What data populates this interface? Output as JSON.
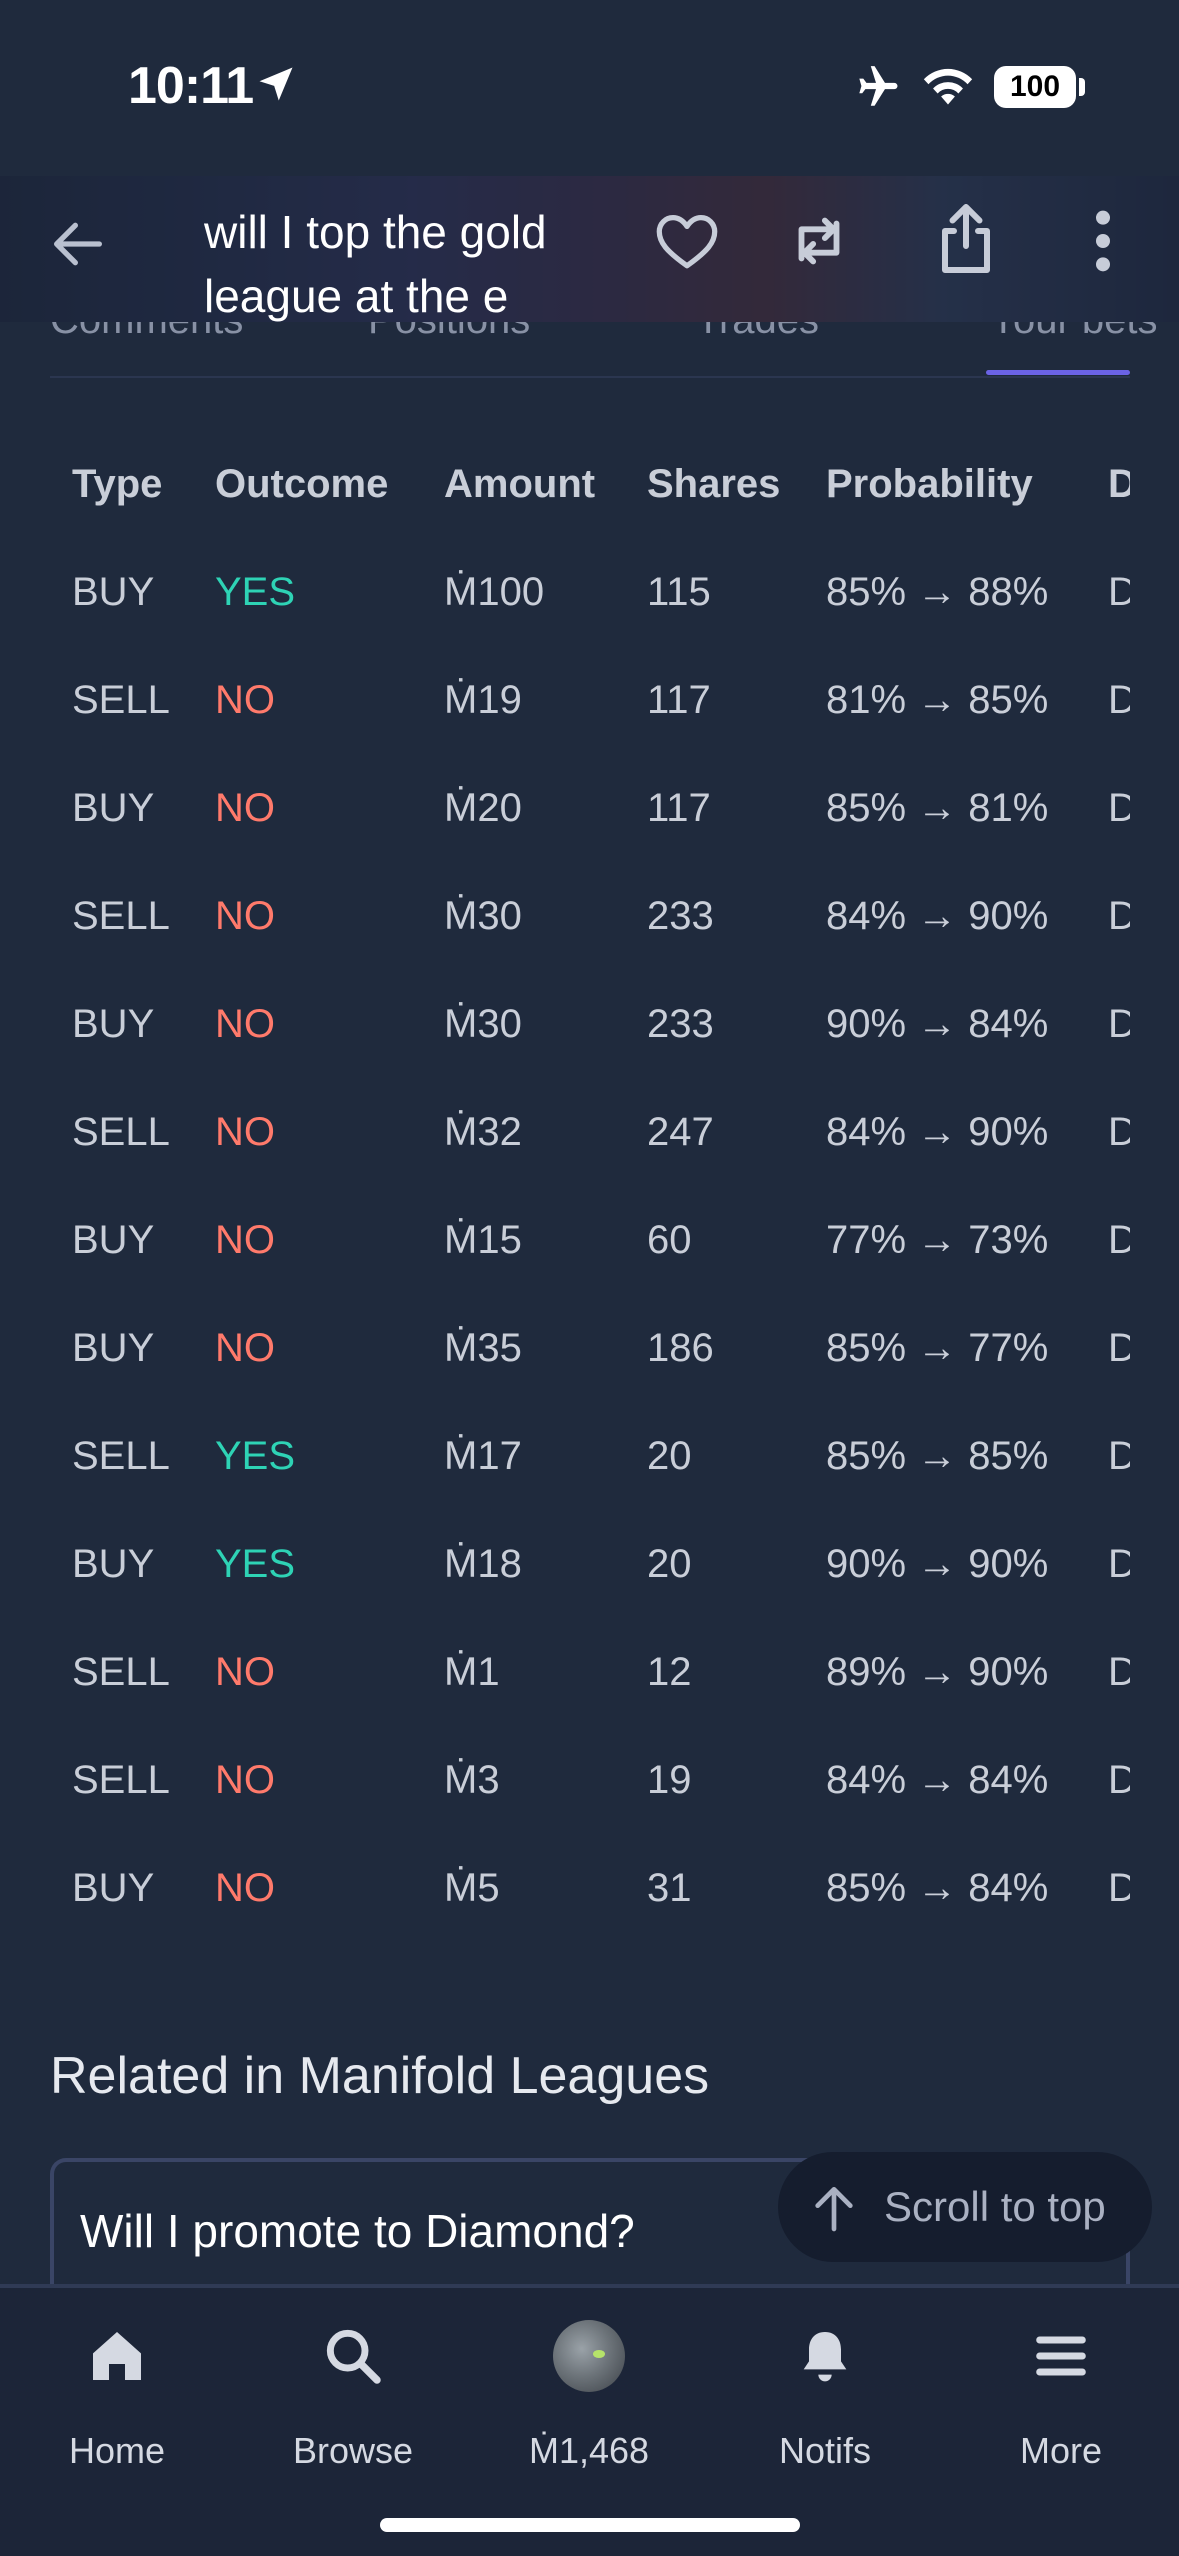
{
  "status_bar": {
    "time": "10:11",
    "battery": "100"
  },
  "header": {
    "title": "will I top the gold league at the e"
  },
  "tabs": [
    {
      "label": "Comments"
    },
    {
      "label": "Positions"
    },
    {
      "label": "Trades"
    },
    {
      "label": "Your bets"
    }
  ],
  "table": {
    "columns": [
      "Type",
      "Outcome",
      "Amount",
      "Shares",
      "Probability",
      "D"
    ],
    "rows": [
      {
        "type": "BUY",
        "outcome": "YES",
        "amount": "Ṁ100",
        "shares": "115",
        "prob": "85% → 88%",
        "date": "D"
      },
      {
        "type": "SELL",
        "outcome": "NO",
        "amount": "Ṁ19",
        "shares": "117",
        "prob": "81% → 85%",
        "date": "D"
      },
      {
        "type": "BUY",
        "outcome": "NO",
        "amount": "Ṁ20",
        "shares": "117",
        "prob": "85% → 81%",
        "date": "D"
      },
      {
        "type": "SELL",
        "outcome": "NO",
        "amount": "Ṁ30",
        "shares": "233",
        "prob": "84% → 90%",
        "date": "D"
      },
      {
        "type": "BUY",
        "outcome": "NO",
        "amount": "Ṁ30",
        "shares": "233",
        "prob": "90% → 84%",
        "date": "D"
      },
      {
        "type": "SELL",
        "outcome": "NO",
        "amount": "Ṁ32",
        "shares": "247",
        "prob": "84% → 90%",
        "date": "D"
      },
      {
        "type": "BUY",
        "outcome": "NO",
        "amount": "Ṁ15",
        "shares": "60",
        "prob": "77% → 73%",
        "date": "D"
      },
      {
        "type": "BUY",
        "outcome": "NO",
        "amount": "Ṁ35",
        "shares": "186",
        "prob": "85% → 77%",
        "date": "D"
      },
      {
        "type": "SELL",
        "outcome": "YES",
        "amount": "Ṁ17",
        "shares": "20",
        "prob": "85% → 85%",
        "date": "D"
      },
      {
        "type": "BUY",
        "outcome": "YES",
        "amount": "Ṁ18",
        "shares": "20",
        "prob": "90% → 90%",
        "date": "D"
      },
      {
        "type": "SELL",
        "outcome": "NO",
        "amount": "Ṁ1",
        "shares": "12",
        "prob": "89% → 90%",
        "date": "D"
      },
      {
        "type": "SELL",
        "outcome": "NO",
        "amount": "Ṁ3",
        "shares": "19",
        "prob": "84% → 84%",
        "date": "D"
      },
      {
        "type": "BUY",
        "outcome": "NO",
        "amount": "Ṁ5",
        "shares": "31",
        "prob": "85% → 84%",
        "date": "D"
      }
    ]
  },
  "related": {
    "heading": "Related in Manifold Leagues",
    "card_title": "Will I promote to Diamond?"
  },
  "scroll_top": {
    "label": "Scroll to top"
  },
  "bottom_nav": {
    "home": "Home",
    "browse": "Browse",
    "balance": "Ṁ1,468",
    "notifs": "Notifs",
    "more": "More"
  },
  "colors": {
    "background": "#1f2a3d",
    "yes": "#2ed3b5",
    "no": "#ff7a6b",
    "accent": "#6b63e6"
  }
}
